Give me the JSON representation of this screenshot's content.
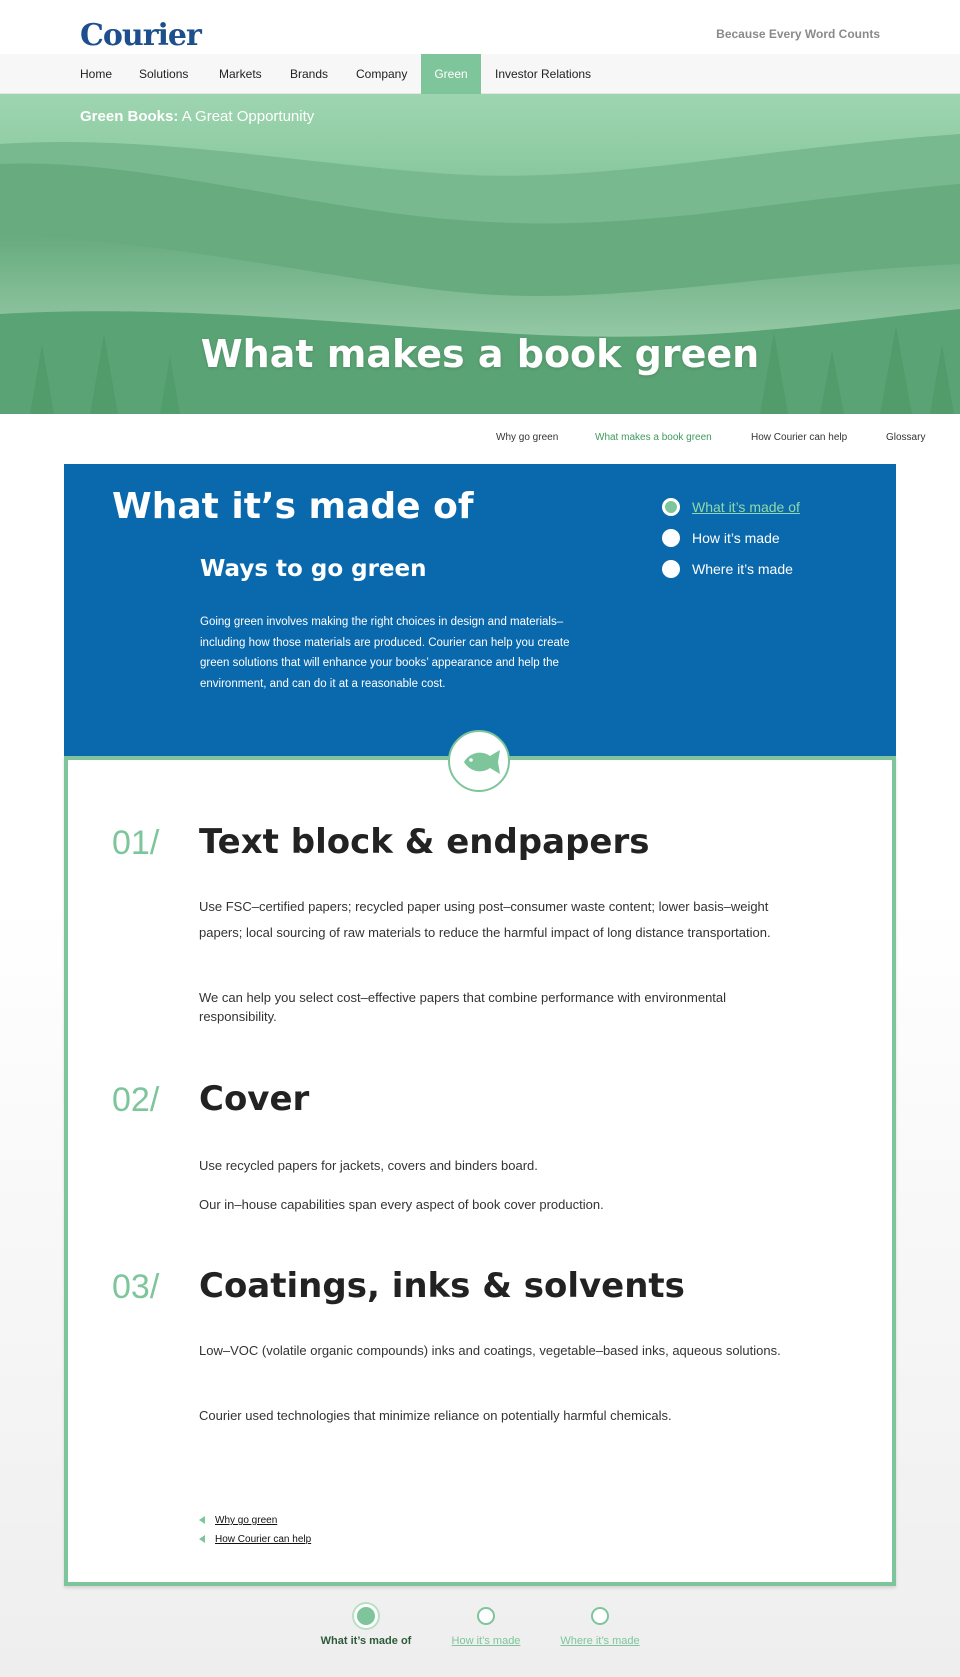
{
  "header": {
    "logo": "Courier",
    "tagline": "Because Every Word Counts"
  },
  "nav": {
    "items": [
      {
        "label": "Home"
      },
      {
        "label": "Solutions"
      },
      {
        "label": "Markets"
      },
      {
        "label": "Brands"
      },
      {
        "label": "Company"
      },
      {
        "label": "Green",
        "active": true
      },
      {
        "label": "Investor Relations"
      }
    ]
  },
  "hero": {
    "eyebrow_bold": "Green Books:",
    "eyebrow_rest": " A Great Opportunity",
    "title": "What makes a book green"
  },
  "subnav": {
    "items": [
      {
        "label": "Why go green"
      },
      {
        "label": "What makes a book green",
        "active": true
      },
      {
        "label": "How Courier can help"
      },
      {
        "label": "Glossary"
      }
    ]
  },
  "panel": {
    "title": "What it’s made of",
    "subtitle": "Ways to go green",
    "text": "Going green involves making the right choices in design and materials–including how those materials are produced. Courier can help you create green solutions that will enhance your books’ appearance and help the environment, and can do it at a reasonable cost.",
    "toc": [
      {
        "label": "What it’s made of",
        "active": true
      },
      {
        "label": "How it’s made"
      },
      {
        "label": "Where it’s made"
      }
    ]
  },
  "sections": [
    {
      "num": "01/",
      "title": "Text block & endpapers",
      "p1": "Use FSC–certified papers; recycled paper using post–consumer waste content; lower basis–weight papers; local sourcing of raw materials to reduce the harmful impact of long distance transportation.",
      "p2": "We can help you select cost–effective papers that combine performance with environmental responsibility."
    },
    {
      "num": "02/",
      "title": "Cover",
      "p1": "Use recycled papers for jackets, covers and binders board.",
      "p2": "Our in–house capabilities span every aspect of book cover production."
    },
    {
      "num": "03/",
      "title": "Coatings, inks & solvents",
      "p1": "Low–VOC (volatile organic compounds) inks and coatings, vegetable–based inks, aqueous solutions.",
      "p2": "Courier used technologies that minimize reliance on potentially harmful chemicals."
    }
  ],
  "related": [
    {
      "label": "Why go green"
    },
    {
      "label": "How Courier can help"
    }
  ],
  "pager": [
    {
      "label": "What it’s made of",
      "active": true
    },
    {
      "label": "How it’s made"
    },
    {
      "label": "Where it’s made"
    }
  ],
  "colors": {
    "brand_blue": "#0a69ad",
    "accent_green": "#7ec59b",
    "logo_blue": "#1c4f8c"
  }
}
